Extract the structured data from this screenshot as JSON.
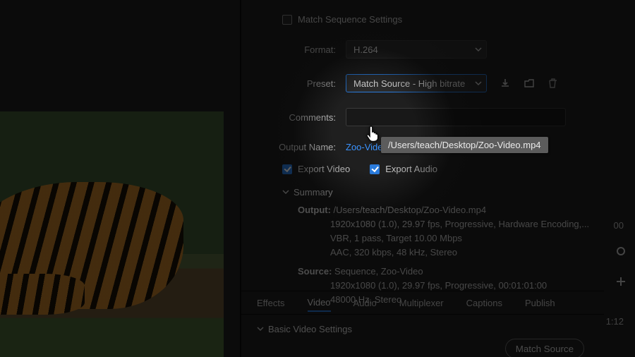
{
  "colors": {
    "accent": "#2a7bdc",
    "link": "#3a93ff"
  },
  "match_sequence": {
    "label": "Match Sequence Settings",
    "checked": false
  },
  "fields": {
    "format_label": "Format:",
    "format_value": "H.264",
    "preset_label": "Preset:",
    "preset_value": "Match Source - High bitrate",
    "comments_label": "Comments:",
    "comments_value": "",
    "output_name_label": "Output Name:",
    "output_name_value": "Zoo-Video.mp4",
    "output_path_tooltip": "/Users/teach/Desktop/Zoo-Video.mp4"
  },
  "export_checks": {
    "video_label": "Export Video",
    "video_checked": true,
    "audio_label": "Export Audio",
    "audio_checked": true
  },
  "summary": {
    "title": "Summary",
    "output_label": "Output:",
    "output_path": "/Users/teach/Desktop/Zoo-Video.mp4",
    "output_line2": "1920x1080 (1.0), 29.97 fps, Progressive, Hardware Encoding,...",
    "output_line3": "VBR, 1 pass, Target 10.00 Mbps",
    "output_line4": "AAC, 320 kbps, 48 kHz, Stereo",
    "source_label": "Source:",
    "source_name": "Sequence, Zoo-Video",
    "source_line2": "1920x1080 (1.0), 29.97 fps, Progressive, 00:01:01:00",
    "source_line3": "48000 Hz, Stereo"
  },
  "tabs": [
    "Effects",
    "Video",
    "Audio",
    "Multiplexer",
    "Captions",
    "Publish"
  ],
  "active_tab_index": 1,
  "basic_video": {
    "title": "Basic Video Settings",
    "match_source_btn": "Match Source"
  },
  "gutter": {
    "time_fragment_top": "00",
    "time_fragment_mid": "1:12",
    "plus": "+"
  }
}
